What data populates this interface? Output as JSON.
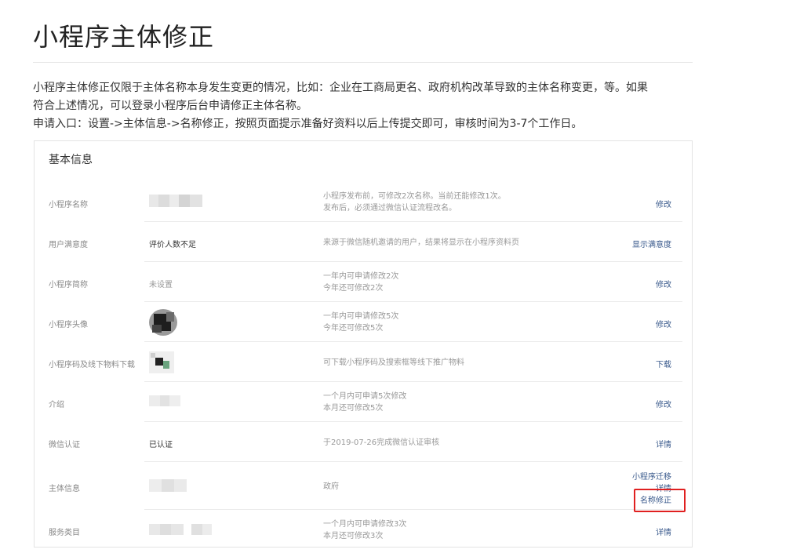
{
  "page": {
    "title": "小程序主体修正",
    "intro_line1": "小程序主体修正仅限于主体名称本身发生变更的情况，比如：企业在工商局更名、政府机构改革导致的主体名称变更，等。如果",
    "intro_line2": "符合上述情况，可以登录小程序后台申请修正主体名称。",
    "intro_line3": "申请入口：设置->主体信息->名称修正，按照页面提示准备好资料以后上传提交即可，审核时间为3-7个工作日。"
  },
  "panel": {
    "title": "基本信息",
    "rows": [
      {
        "label": "小程序名称",
        "value": "",
        "desc": [
          "小程序发布前，可修改2次名称。当前还能修改1次。",
          "发布后，必须通过微信认证流程改名。"
        ],
        "actions": [
          "修改"
        ]
      },
      {
        "label": "用户满意度",
        "value": "评价人数不足",
        "desc": [
          "来源于微信随机邀请的用户，结果将显示在小程序资料页"
        ],
        "actions": [
          "显示满意度"
        ]
      },
      {
        "label": "小程序简称",
        "value": "未设置",
        "desc": [
          "一年内可申请修改2次",
          "今年还可修改2次"
        ],
        "actions": [
          "修改"
        ]
      },
      {
        "label": "小程序头像",
        "value": "",
        "desc": [
          "一年内可申请修改5次",
          "今年还可修改5次"
        ],
        "actions": [
          "修改"
        ]
      },
      {
        "label": "小程序码及线下物料下载",
        "value": "",
        "desc": [
          "可下载小程序码及搜索框等线下推广物料"
        ],
        "actions": [
          "下载"
        ]
      },
      {
        "label": "介绍",
        "value": "",
        "desc": [
          "一个月内可申请5次修改",
          "本月还可修改5次"
        ],
        "actions": [
          "修改"
        ]
      },
      {
        "label": "微信认证",
        "value": "已认证",
        "desc": [
          "于2019-07-26完成微信认证审核"
        ],
        "actions": [
          "详情"
        ]
      },
      {
        "label": "主体信息",
        "value": "",
        "desc": [
          "政府"
        ],
        "actions": [
          "小程序迁移",
          "详情",
          "名称修正"
        ]
      },
      {
        "label": "服务类目",
        "value": "",
        "desc": [
          "一个月内可申请修改3次",
          "本月还可修改3次"
        ],
        "actions": [
          "详情"
        ]
      }
    ]
  },
  "colors": {
    "link": "#3a5a8c",
    "highlight": "#e02020"
  }
}
